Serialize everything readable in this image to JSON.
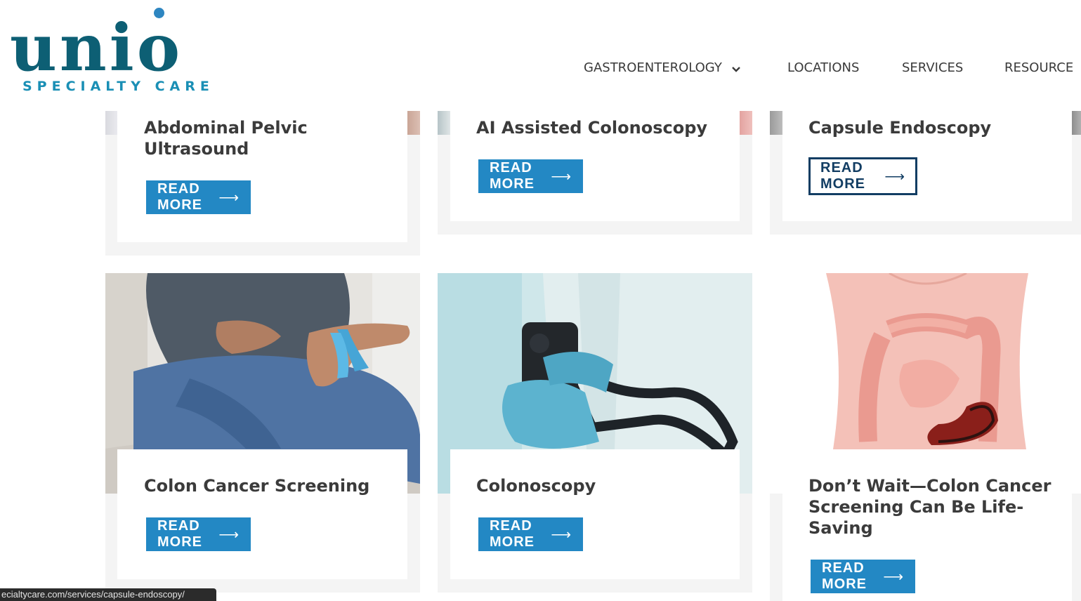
{
  "header": {
    "logo": {
      "word": "unio",
      "tagline": "SPECIALTY CARE"
    },
    "nav": [
      {
        "label": "GASTROENTEROLOGY",
        "has_dropdown": true
      },
      {
        "label": "LOCATIONS"
      },
      {
        "label": "SERVICES"
      },
      {
        "label": "RESOURCE"
      }
    ]
  },
  "cards": [
    {
      "title": "Abdominal Pelvic Ultrasound",
      "button": "READ MORE"
    },
    {
      "title": "AI Assisted Colonoscopy",
      "button": "READ MORE"
    },
    {
      "title": "Capsule Endoscopy",
      "button": "READ MORE"
    },
    {
      "title": "Colon Cancer Screening",
      "button": "READ MORE",
      "image": "patient-holding-blue-ribbon"
    },
    {
      "title": "Colonoscopy",
      "button": "READ MORE",
      "image": "doctor-holding-endoscope"
    },
    {
      "title": "Don’t Wait—Colon Cancer Screening Can Be Life-Saving",
      "button": "READ MORE",
      "image": "colon-anatomy-illustration"
    }
  ],
  "button_arrow": "⟶",
  "status_url": "ecialtycare.com/services/capsule-endoscopy/",
  "colors": {
    "brand": "#0d5f74",
    "accent": "#2388c4",
    "outline_button": "#123d63",
    "card_bg": "#f4f4f4"
  }
}
